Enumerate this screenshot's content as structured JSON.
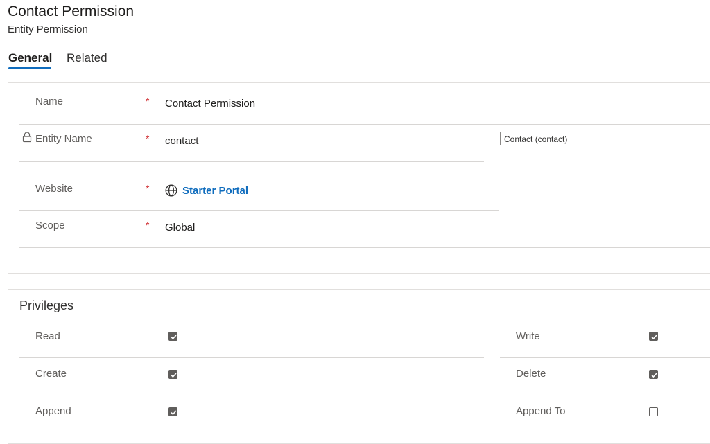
{
  "header": {
    "title": "Contact Permission",
    "subtitle": "Entity Permission"
  },
  "tabs": [
    {
      "label": "General",
      "active": true
    },
    {
      "label": "Related",
      "active": false
    }
  ],
  "general": {
    "required_marker": "*",
    "name": {
      "label": "Name",
      "value": "Contact Permission"
    },
    "entity_name": {
      "label": "Entity Name",
      "value": "contact",
      "lookup_value": "Contact (contact)",
      "icon": "lock-icon"
    },
    "website": {
      "label": "Website",
      "value": "Starter Portal",
      "icon": "globe-icon"
    },
    "scope": {
      "label": "Scope",
      "value": "Global"
    }
  },
  "privileges": {
    "title": "Privileges",
    "items": [
      {
        "label": "Read",
        "checked": true
      },
      {
        "label": "Write",
        "checked": true
      },
      {
        "label": "Create",
        "checked": true
      },
      {
        "label": "Delete",
        "checked": true
      },
      {
        "label": "Append",
        "checked": true
      },
      {
        "label": "Append To",
        "checked": false
      }
    ]
  },
  "colors": {
    "accent": "#0f6cbd",
    "required": "#d13438",
    "checkbox": "#605e5c"
  }
}
